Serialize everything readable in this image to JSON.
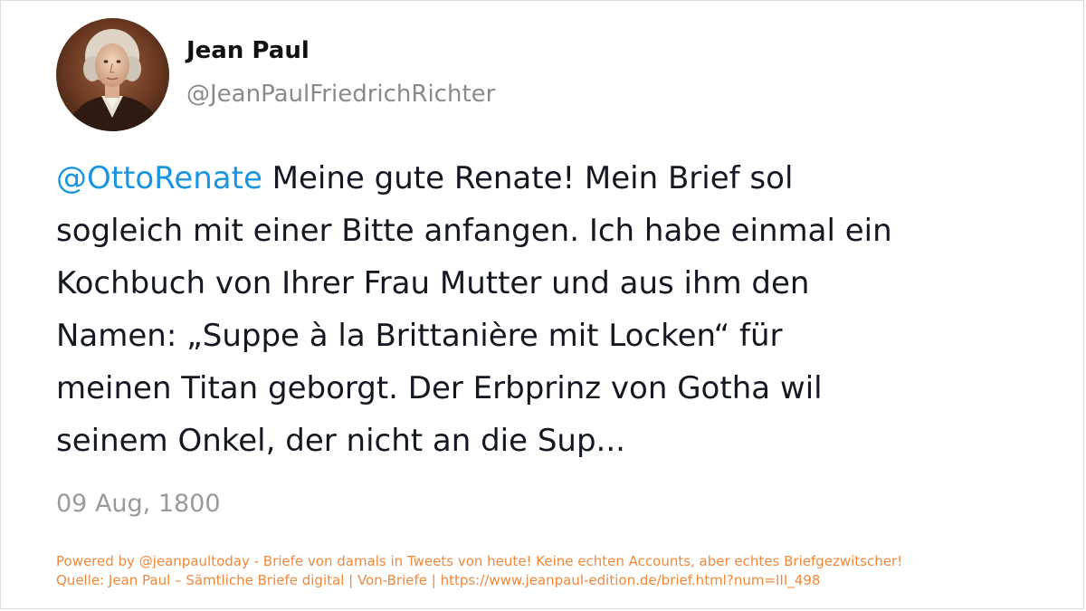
{
  "author": {
    "name": "Jean Paul",
    "handle": "@JeanPaulFriedrichRichter"
  },
  "tweet": {
    "mention": "@OttoRenate",
    "lines": [
      " Meine gute Renate! Mein Brief sol",
      "sogleich mit einer Bitte anfangen. Ich habe einmal ein",
      "Kochbuch von Ihrer Frau Mutter und aus ihm den",
      "Namen: „Suppe à la Brittanière mit Locken“ für",
      "meinen Titan geborgt. Der Erbprinz von Gotha wil",
      "seinem Onkel, der nicht an die Sup..."
    ],
    "date": "09 Aug, 1800"
  },
  "footer": {
    "powered_by": "Powered by @jeanpaultoday - Briefe von damals in Tweets von heute! Keine echten Accounts, aber echtes Briefgezwitscher!",
    "source": "Quelle: Jean Paul – Sämtliche Briefe digital | Von-Briefe | https://www.jeanpaul-edition.de/brief.html?num=III_498"
  },
  "colors": {
    "mention": "#1b95e0",
    "text": "#141823",
    "muted": "#9a9a9a",
    "footer": "#f0883a"
  },
  "icons": {
    "avatar": "portrait-avatar"
  }
}
